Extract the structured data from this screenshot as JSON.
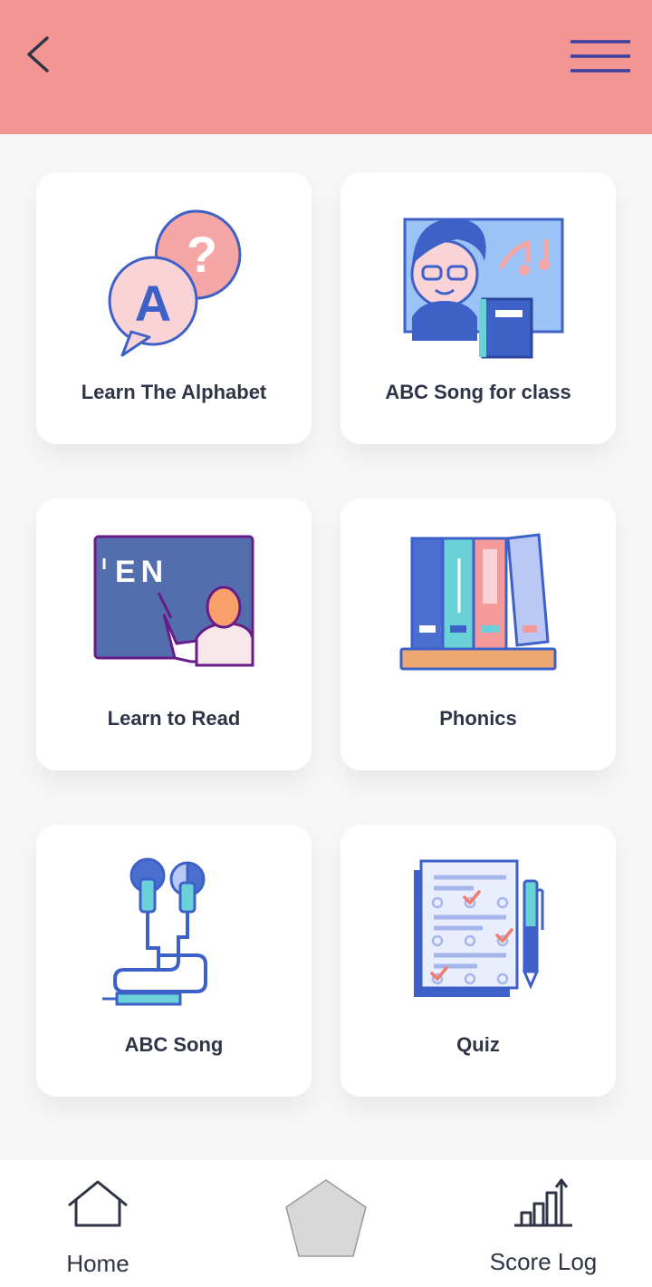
{
  "header": {
    "back_icon": "chevron-left-icon",
    "menu_icon": "hamburger-menu-icon",
    "background": "#f39593"
  },
  "cards": [
    {
      "label": "Learn The Alphabet",
      "icon": "alphabet-speech-bubbles-icon"
    },
    {
      "label": "ABC Song for class",
      "icon": "teacher-music-board-icon"
    },
    {
      "label": "Learn to Read",
      "icon": "en-chalkboard-teacher-icon"
    },
    {
      "label": "Phonics",
      "icon": "books-shelf-icon"
    },
    {
      "label": "ABC Song",
      "icon": "earphones-icon"
    },
    {
      "label": "Quiz",
      "icon": "quiz-checklist-icon"
    }
  ],
  "bottom_nav": {
    "home_label": "Home",
    "score_label": "Score Log",
    "center_icon": "pentagon-icon"
  },
  "colors": {
    "accent": "#f39593",
    "text": "#2f3547",
    "blue": "#4a6fd0",
    "pink": "#f7a6a6"
  }
}
